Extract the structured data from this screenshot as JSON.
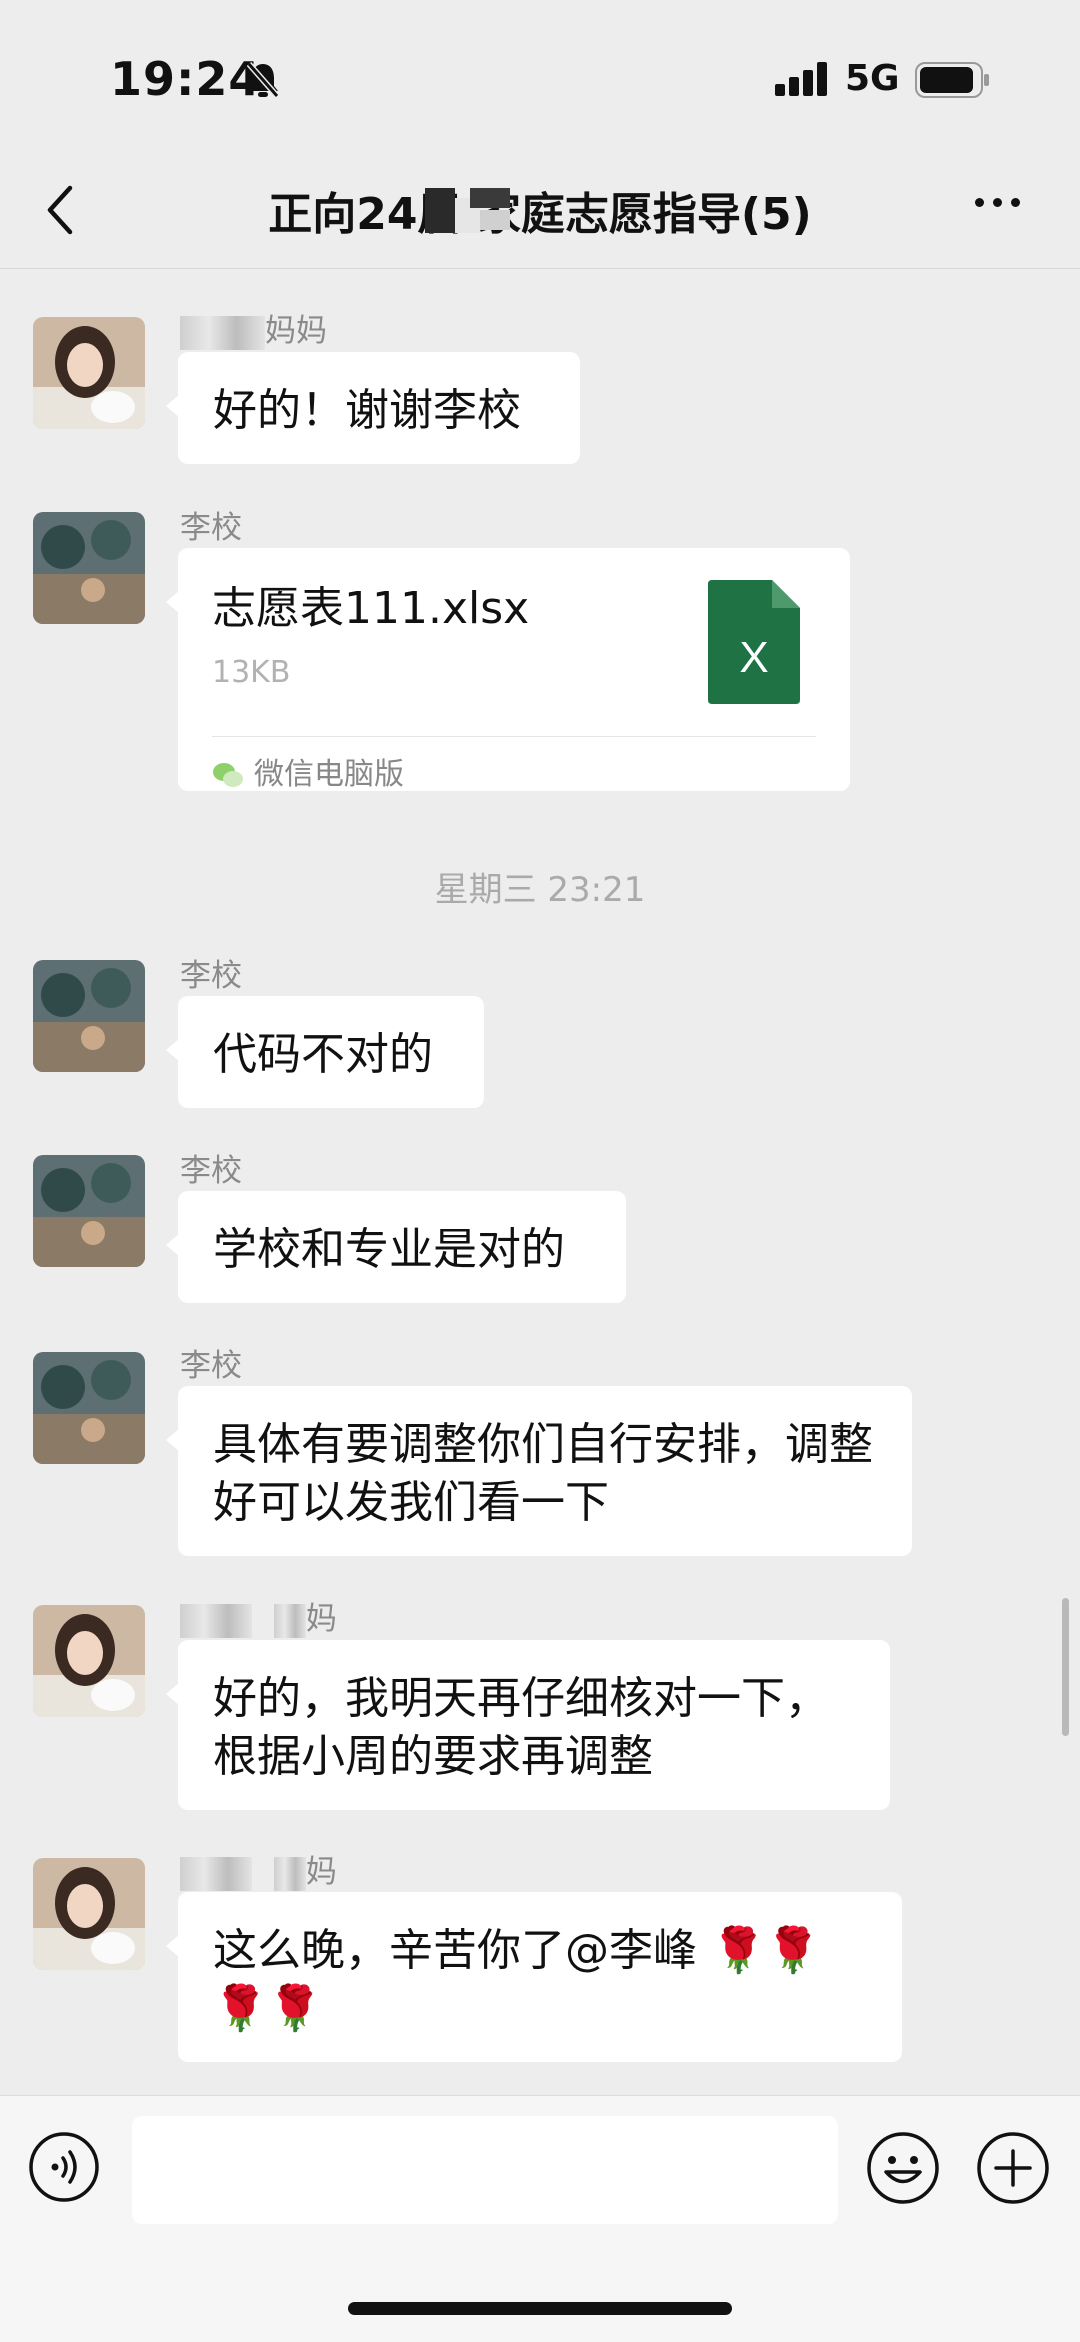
{
  "status_bar": {
    "time": "19:24",
    "network": "5G"
  },
  "header": {
    "title": "正向24届  家庭志愿指导(5)"
  },
  "messages": [
    {
      "sender": "妈妈",
      "text": "好的！谢谢李校"
    },
    {
      "sender": "李校",
      "file_name": "志愿表111.xlsx",
      "file_size": "13KB",
      "file_icon_text": "X",
      "source": "微信电脑版"
    },
    {
      "sender": "李校",
      "text": "代码不对的"
    },
    {
      "sender": "李校",
      "text": "学校和专业是对的"
    },
    {
      "sender": "李校",
      "text": "具体有要调整你们自行安排，调整好可以发我们看一下"
    },
    {
      "sender": "妈",
      "text": "好的，我明天再仔细核对一下，根据小周的要求再调整"
    },
    {
      "sender": "妈",
      "text": "这么晚，辛苦你了@李峰 🌹🌹🌹🌹"
    }
  ],
  "time_separator": "星期三 23:21",
  "colors": {
    "background": "#ededed",
    "bubble": "#ffffff",
    "excel_green": "#1f7244"
  },
  "icons": {
    "voice": "voice-icon",
    "emoji": "emoji-icon",
    "plus": "plus-icon",
    "back": "back-arrow-icon",
    "more": "more-icon"
  }
}
